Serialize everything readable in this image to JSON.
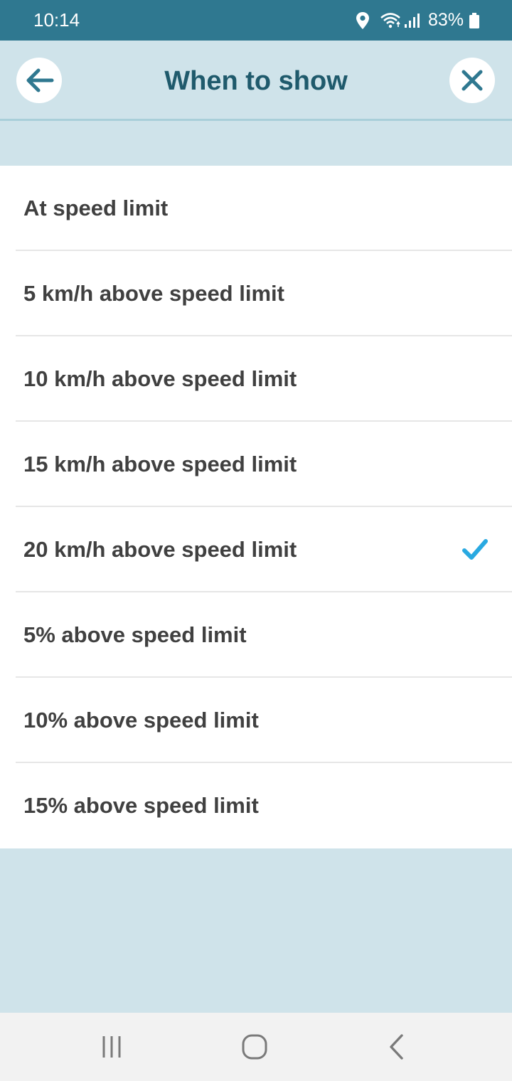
{
  "status_bar": {
    "time": "10:14",
    "battery": "83%",
    "icons": [
      "location-icon",
      "wifi-icon",
      "signal-icon",
      "battery-icon"
    ]
  },
  "header": {
    "title": "When to show",
    "back_icon": "arrow-left-icon",
    "close_icon": "close-icon"
  },
  "options": [
    {
      "label": "At speed limit",
      "selected": false
    },
    {
      "label": "5 km/h above speed limit",
      "selected": false
    },
    {
      "label": "10 km/h above speed limit",
      "selected": false
    },
    {
      "label": "15 km/h above speed limit",
      "selected": false
    },
    {
      "label": "20 km/h above speed limit",
      "selected": true
    },
    {
      "label": "5% above speed limit",
      "selected": false
    },
    {
      "label": "10% above speed limit",
      "selected": false
    },
    {
      "label": "15% above speed limit",
      "selected": false
    }
  ],
  "nav_bar": {
    "icons": [
      "recent-apps-icon",
      "home-icon",
      "back-icon"
    ]
  },
  "colors": {
    "status_bar": "#2f7890",
    "header_bg": "#cfe3ea",
    "title": "#1f5a6c",
    "check": "#29a9e1",
    "text": "#404040"
  }
}
